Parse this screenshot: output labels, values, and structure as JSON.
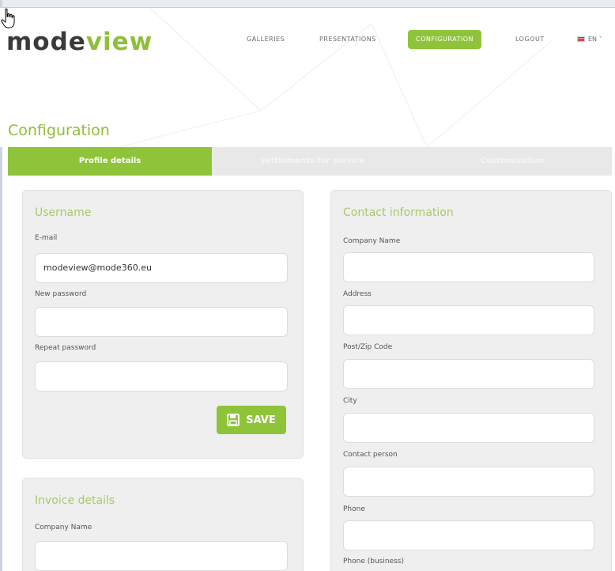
{
  "header": {
    "logo_part1": "mode",
    "logo_part2": "view",
    "nav": [
      {
        "label": "GALLERIES"
      },
      {
        "label": "PRESENTATIONS"
      },
      {
        "label": "CONFIGURATION"
      },
      {
        "label": "LOGOUT"
      }
    ],
    "language": "EN",
    "language_caret": "˅"
  },
  "page": {
    "title": "Configuration"
  },
  "tabs": [
    {
      "label": "Profile details"
    },
    {
      "label": "Settlements for service"
    },
    {
      "label": "Customization"
    }
  ],
  "username_panel": {
    "title": "Username",
    "email_label": "E-mail",
    "email_value": "modeview@mode360.eu",
    "new_password_label": "New password",
    "repeat_password_label": "Repeat password",
    "save_label": "SAVE"
  },
  "invoice_panel": {
    "title": "Invoice details",
    "company_label": "Company Name"
  },
  "contact_panel": {
    "title": "Contact information",
    "fields": [
      {
        "label": "Company Name"
      },
      {
        "label": "Address"
      },
      {
        "label": "Post/Zip Code"
      },
      {
        "label": "City"
      },
      {
        "label": "Contact person"
      },
      {
        "label": "Phone"
      },
      {
        "label": "Phone (business)"
      }
    ]
  },
  "colors": {
    "accent": "#8fc43a",
    "panel_bg": "#efefef",
    "title_green": "#a7c96a"
  }
}
